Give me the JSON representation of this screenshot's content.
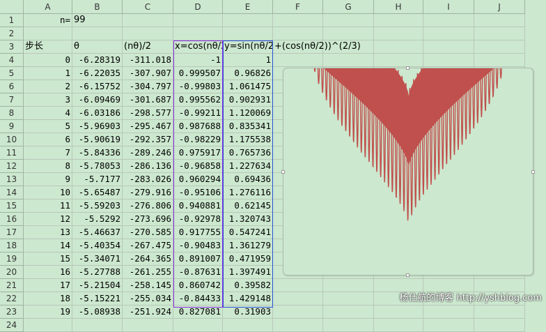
{
  "columns": [
    "A",
    "B",
    "C",
    "D",
    "E",
    "F",
    "G",
    "H",
    "I",
    "J"
  ],
  "rows": [
    "1",
    "2",
    "3",
    "4",
    "5",
    "6",
    "7",
    "8",
    "9",
    "10",
    "11",
    "12",
    "13",
    "14",
    "15",
    "16",
    "17",
    "18",
    "19",
    "20",
    "21",
    "22",
    "23",
    "24"
  ],
  "header_row1": {
    "label": "n=",
    "value": "99"
  },
  "header_row3": {
    "a": "步长",
    "b": "θ",
    "c": "(nθ)/2",
    "d": "x=cos(nθ/2",
    "e": "y=sin(nθ/2",
    "f": "+(cos(nθ/2))^(2/3)"
  },
  "data_rows": [
    [
      "0",
      "-6.28319",
      "-311.018",
      "-1",
      "1"
    ],
    [
      "1",
      "-6.22035",
      "-307.907",
      "0.999507",
      "0.96826"
    ],
    [
      "2",
      "-6.15752",
      "-304.797",
      "-0.99803",
      "1.061475"
    ],
    [
      "3",
      "-6.09469",
      "-301.687",
      "0.995562",
      "0.902931"
    ],
    [
      "4",
      "-6.03186",
      "-298.577",
      "-0.99211",
      "1.120069"
    ],
    [
      "5",
      "-5.96903",
      "-295.467",
      "0.987688",
      "0.835341"
    ],
    [
      "6",
      "-5.90619",
      "-292.357",
      "-0.98229",
      "1.175538"
    ],
    [
      "7",
      "-5.84336",
      "-289.246",
      "0.975917",
      "0.765736"
    ],
    [
      "8",
      "-5.78053",
      "-286.136",
      "-0.96858",
      "1.227634"
    ],
    [
      "9",
      "-5.7177",
      "-283.026",
      "0.960294",
      "0.69436"
    ],
    [
      "10",
      "-5.65487",
      "-279.916",
      "-0.95106",
      "1.276116"
    ],
    [
      "11",
      "-5.59203",
      "-276.806",
      "0.940881",
      "0.62145"
    ],
    [
      "12",
      "-5.5292",
      "-273.696",
      "-0.92978",
      "1.320743"
    ],
    [
      "13",
      "-5.46637",
      "-270.585",
      "0.917755",
      "0.547241"
    ],
    [
      "14",
      "-5.40354",
      "-267.475",
      "-0.90483",
      "1.361279"
    ],
    [
      "15",
      "-5.34071",
      "-264.365",
      "0.891007",
      "0.471959"
    ],
    [
      "16",
      "-5.27788",
      "-261.255",
      "-0.87631",
      "1.397491"
    ],
    [
      "17",
      "-5.21504",
      "-258.145",
      "0.860742",
      "0.39582"
    ],
    [
      "18",
      "-5.15221",
      "-255.034",
      "-0.84433",
      "1.429148"
    ],
    [
      "19",
      "-5.08938",
      "-251.924",
      "0.827081",
      "0.31903"
    ]
  ],
  "chart": {
    "fill_color": "#c0504d",
    "background": "#cce8cf"
  },
  "watermark": "杨仕航的博客 http://yshblog.com"
}
